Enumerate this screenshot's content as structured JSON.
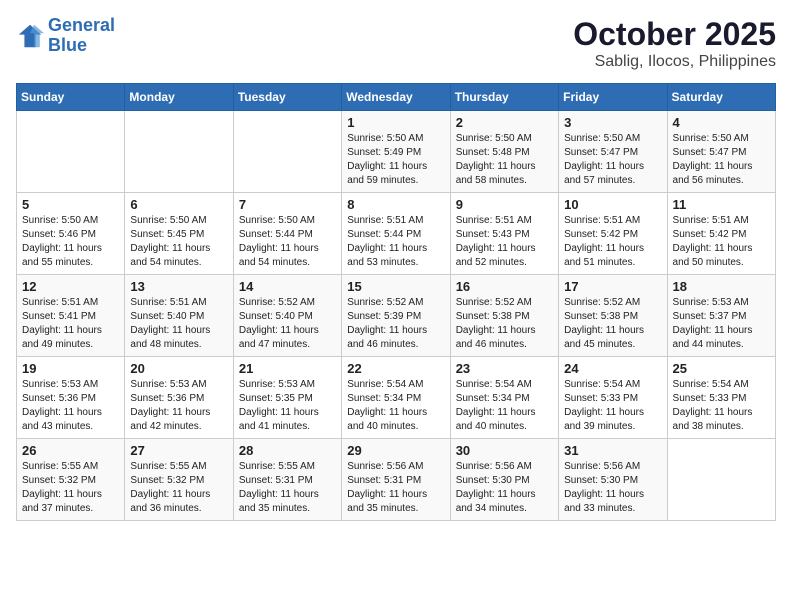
{
  "logo": {
    "line1": "General",
    "line2": "Blue"
  },
  "title": "October 2025",
  "location": "Sablig, Ilocos, Philippines",
  "days_of_week": [
    "Sunday",
    "Monday",
    "Tuesday",
    "Wednesday",
    "Thursday",
    "Friday",
    "Saturday"
  ],
  "weeks": [
    [
      null,
      null,
      null,
      {
        "day": 1,
        "sunrise": "5:50 AM",
        "sunset": "5:49 PM",
        "daylight": "11 hours and 59 minutes."
      },
      {
        "day": 2,
        "sunrise": "5:50 AM",
        "sunset": "5:48 PM",
        "daylight": "11 hours and 58 minutes."
      },
      {
        "day": 3,
        "sunrise": "5:50 AM",
        "sunset": "5:47 PM",
        "daylight": "11 hours and 57 minutes."
      },
      {
        "day": 4,
        "sunrise": "5:50 AM",
        "sunset": "5:47 PM",
        "daylight": "11 hours and 56 minutes."
      }
    ],
    [
      {
        "day": 5,
        "sunrise": "5:50 AM",
        "sunset": "5:46 PM",
        "daylight": "11 hours and 55 minutes."
      },
      {
        "day": 6,
        "sunrise": "5:50 AM",
        "sunset": "5:45 PM",
        "daylight": "11 hours and 54 minutes."
      },
      {
        "day": 7,
        "sunrise": "5:50 AM",
        "sunset": "5:44 PM",
        "daylight": "11 hours and 54 minutes."
      },
      {
        "day": 8,
        "sunrise": "5:51 AM",
        "sunset": "5:44 PM",
        "daylight": "11 hours and 53 minutes."
      },
      {
        "day": 9,
        "sunrise": "5:51 AM",
        "sunset": "5:43 PM",
        "daylight": "11 hours and 52 minutes."
      },
      {
        "day": 10,
        "sunrise": "5:51 AM",
        "sunset": "5:42 PM",
        "daylight": "11 hours and 51 minutes."
      },
      {
        "day": 11,
        "sunrise": "5:51 AM",
        "sunset": "5:42 PM",
        "daylight": "11 hours and 50 minutes."
      }
    ],
    [
      {
        "day": 12,
        "sunrise": "5:51 AM",
        "sunset": "5:41 PM",
        "daylight": "11 hours and 49 minutes."
      },
      {
        "day": 13,
        "sunrise": "5:51 AM",
        "sunset": "5:40 PM",
        "daylight": "11 hours and 48 minutes."
      },
      {
        "day": 14,
        "sunrise": "5:52 AM",
        "sunset": "5:40 PM",
        "daylight": "11 hours and 47 minutes."
      },
      {
        "day": 15,
        "sunrise": "5:52 AM",
        "sunset": "5:39 PM",
        "daylight": "11 hours and 46 minutes."
      },
      {
        "day": 16,
        "sunrise": "5:52 AM",
        "sunset": "5:38 PM",
        "daylight": "11 hours and 46 minutes."
      },
      {
        "day": 17,
        "sunrise": "5:52 AM",
        "sunset": "5:38 PM",
        "daylight": "11 hours and 45 minutes."
      },
      {
        "day": 18,
        "sunrise": "5:53 AM",
        "sunset": "5:37 PM",
        "daylight": "11 hours and 44 minutes."
      }
    ],
    [
      {
        "day": 19,
        "sunrise": "5:53 AM",
        "sunset": "5:36 PM",
        "daylight": "11 hours and 43 minutes."
      },
      {
        "day": 20,
        "sunrise": "5:53 AM",
        "sunset": "5:36 PM",
        "daylight": "11 hours and 42 minutes."
      },
      {
        "day": 21,
        "sunrise": "5:53 AM",
        "sunset": "5:35 PM",
        "daylight": "11 hours and 41 minutes."
      },
      {
        "day": 22,
        "sunrise": "5:54 AM",
        "sunset": "5:34 PM",
        "daylight": "11 hours and 40 minutes."
      },
      {
        "day": 23,
        "sunrise": "5:54 AM",
        "sunset": "5:34 PM",
        "daylight": "11 hours and 40 minutes."
      },
      {
        "day": 24,
        "sunrise": "5:54 AM",
        "sunset": "5:33 PM",
        "daylight": "11 hours and 39 minutes."
      },
      {
        "day": 25,
        "sunrise": "5:54 AM",
        "sunset": "5:33 PM",
        "daylight": "11 hours and 38 minutes."
      }
    ],
    [
      {
        "day": 26,
        "sunrise": "5:55 AM",
        "sunset": "5:32 PM",
        "daylight": "11 hours and 37 minutes."
      },
      {
        "day": 27,
        "sunrise": "5:55 AM",
        "sunset": "5:32 PM",
        "daylight": "11 hours and 36 minutes."
      },
      {
        "day": 28,
        "sunrise": "5:55 AM",
        "sunset": "5:31 PM",
        "daylight": "11 hours and 35 minutes."
      },
      {
        "day": 29,
        "sunrise": "5:56 AM",
        "sunset": "5:31 PM",
        "daylight": "11 hours and 35 minutes."
      },
      {
        "day": 30,
        "sunrise": "5:56 AM",
        "sunset": "5:30 PM",
        "daylight": "11 hours and 34 minutes."
      },
      {
        "day": 31,
        "sunrise": "5:56 AM",
        "sunset": "5:30 PM",
        "daylight": "11 hours and 33 minutes."
      },
      null
    ]
  ]
}
